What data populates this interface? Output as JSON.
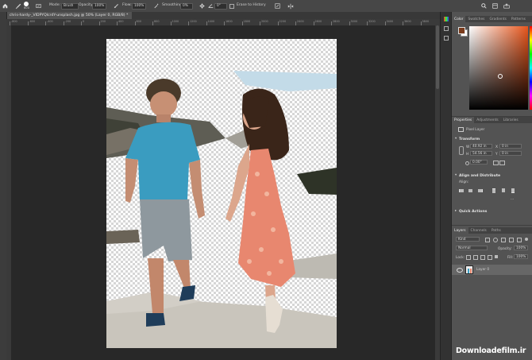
{
  "options_bar": {
    "brush_size": "600",
    "mode_label": "Mode:",
    "mode_value": "Brush",
    "opacity_label": "Opacity:",
    "opacity_value": "100%",
    "flow_label": "Flow:",
    "flow_value": "100%",
    "smoothing_label": "Smoothing:",
    "smoothing_value": "0%",
    "angle_value": "0°",
    "erase_history_label": "Erase to History"
  },
  "document_tab": {
    "close": "×",
    "title": "chris-hardy-_VIDPYQIcrdY-unsplash.jpg @ 50% (Layer 0, RGB/8) *"
  },
  "ruler_ticks": [
    "-800",
    "-600",
    "-400",
    "-200",
    "0",
    "200",
    "400",
    "600",
    "800",
    "1000",
    "1200",
    "1400",
    "1600",
    "1800",
    "2000",
    "2200",
    "2400",
    "2600",
    "2800",
    "3000",
    "3200",
    "3400",
    "3600",
    "3800"
  ],
  "color_panel": {
    "tabs": [
      "Color",
      "Swatches",
      "Gradients",
      "Patterns"
    ],
    "foreground": "#7a3b1c",
    "background": "#ffffff"
  },
  "properties_panel": {
    "tabs": [
      "Properties",
      "Adjustments",
      "Libraries"
    ],
    "layer_type": "Pixel Layer",
    "transform_title": "Transform",
    "w_label": "W",
    "w_value": "40.92 in",
    "x_label": "X",
    "x_value": "0 in",
    "h_label": "H",
    "h_value": "54.56 in",
    "y_label": "Y",
    "y_value": "0 in",
    "angle_value": "0.00°",
    "align_title": "Align and Distribute",
    "align_label": "Align:",
    "quick_actions_title": "Quick Actions"
  },
  "layers_panel": {
    "tabs": [
      "Layers",
      "Channels",
      "Paths"
    ],
    "kind_filter": "Kind",
    "blend_mode": "Normal",
    "opacity_label": "Opacity:",
    "opacity_value": "100%",
    "lock_label": "Lock:",
    "fill_label": "Fill:",
    "fill_value": "100%",
    "layers": [
      {
        "name": "Layer 0",
        "visible": true
      }
    ]
  },
  "watermark": "Downloadefilm.ir",
  "colors": {
    "canvas_bg": "#282828",
    "panel_bg": "#535353",
    "options_bg": "#474747"
  }
}
